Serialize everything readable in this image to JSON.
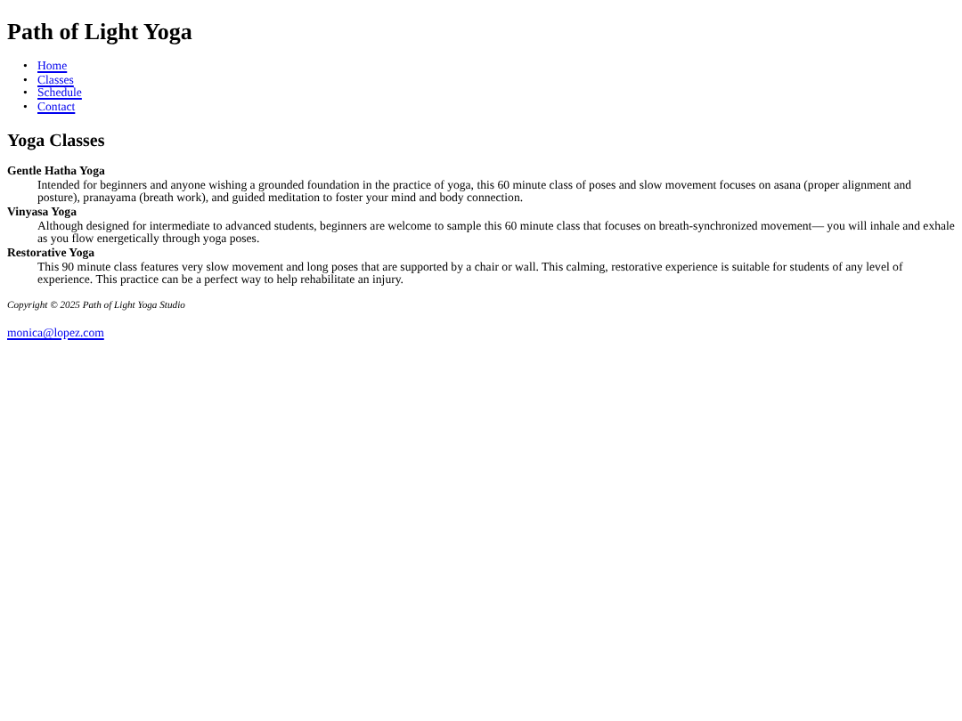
{
  "site_title": "Path of Light Yoga",
  "nav": [
    {
      "marker": "•",
      "label": "Home"
    },
    {
      "marker": "•",
      "label": "Classes"
    },
    {
      "marker": "•",
      "label": "Schedule"
    },
    {
      "marker": "•",
      "label": "Contact"
    }
  ],
  "section_title": "Yoga Classes",
  "classes": [
    {
      "name": "Gentle Hatha Yoga",
      "description": "Intended for beginners and anyone wishing a grounded foundation in the practice of yoga, this 60 minute class of poses and slow movement focuses on asana (proper alignment and posture), pranayama (breath work), and guided meditation to foster your mind and body connection."
    },
    {
      "name": "Vinyasa Yoga",
      "description": "Although designed for intermediate to advanced students, beginners are welcome to sample this 60 minute class that focuses on breath-synchronized movement— you will inhale and exhale as you flow energetically through yoga poses."
    },
    {
      "name": "Restorative Yoga",
      "description": "This 90 minute class features very slow movement and long poses that are supported by a chair or wall. This calming, restorative experience is suitable for students of any level of experience. This practice can be a perfect way to help rehabilitate an injury."
    }
  ],
  "footer": {
    "copyright": "Copyright © 2025 Path of Light Yoga Studio",
    "email": "monica@lopez.com"
  }
}
